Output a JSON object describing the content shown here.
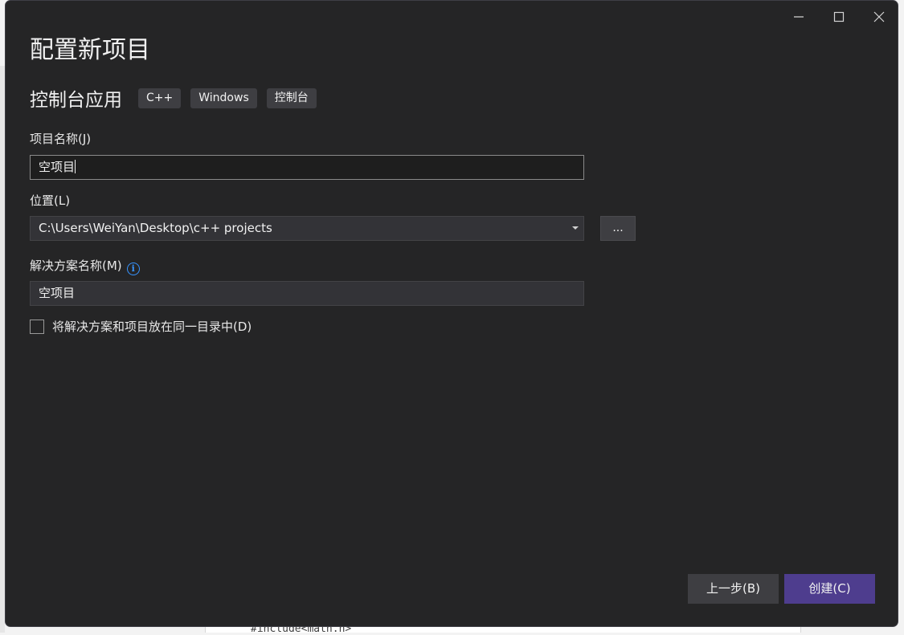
{
  "background_code_line": "#include<math.h>",
  "window_controls": {
    "minimize": "minimize",
    "maximize": "maximize",
    "close": "close"
  },
  "dialog": {
    "title": "配置新项目",
    "template_name": "控制台应用",
    "tags": [
      "C++",
      "Windows",
      "控制台"
    ],
    "project_name": {
      "label": "项目名称(J)",
      "value": "空项目"
    },
    "location": {
      "label": "位置(L)",
      "value": "C:\\Users\\WeiYan\\Desktop\\c++ projects",
      "browse_label": "..."
    },
    "solution_name": {
      "label": "解决方案名称(M)",
      "value": "空项目"
    },
    "same_directory": {
      "label": "将解决方案和项目放在同一目录中(D)",
      "checked": false
    },
    "buttons": {
      "back": "上一步(B)",
      "create": "创建(C)"
    }
  },
  "colors": {
    "dialog_bg": "#252526",
    "accent": "#4e3d8e",
    "info": "#3794ff"
  }
}
